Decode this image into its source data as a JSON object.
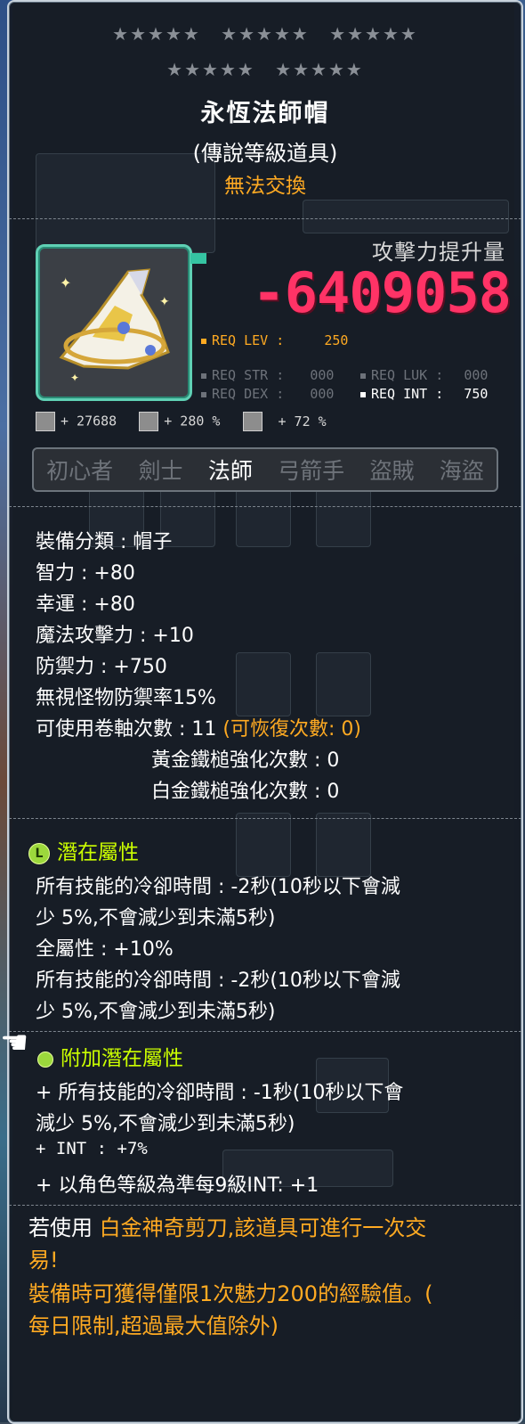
{
  "stars": {
    "row1_groups": 3,
    "row2_groups": 2,
    "per_group": 5,
    "glyph": "★"
  },
  "item": {
    "name": "永恆法師帽",
    "grade": "(傳說等級道具)",
    "trade": "無法交換"
  },
  "attack": {
    "label": "攻擊力提升量",
    "value": "-6409058"
  },
  "req": {
    "lev_label": "REQ LEV :",
    "lev_value": "250",
    "str_label": "REQ STR :",
    "str_value": "000",
    "luk_label": "REQ LUK :",
    "luk_value": "000",
    "dex_label": "REQ DEX :",
    "dex_value": "000",
    "int_label": "REQ INT :",
    "int_value": "750"
  },
  "quick_stats": {
    "a": "+ 27688",
    "b": "+ 280 %",
    "c": "+ 72 %"
  },
  "jobs": [
    "初心者",
    "劍士",
    "法師",
    "弓箭手",
    "盜賊",
    "海盜"
  ],
  "stats": {
    "category": "裝備分類 : 帽子",
    "int": "智力 : +80",
    "luk": "幸運 : +80",
    "matk": "魔法攻擊力 : +10",
    "def": "防禦力 : +750",
    "ignore_def": "無視怪物防禦率15%",
    "scroll_slots": "可使用卷軸次數 : 11",
    "scroll_restore": "(可恢復次數: 0)",
    "gold_hammer": "黃金鐵槌強化次數 : 0",
    "platinum_hammer": "白金鐵槌強化次數 : 0"
  },
  "potential": {
    "header": "潛在屬性",
    "badge": "L",
    "lines": [
      "所有技能的冷卻時間 : -2秒(10秒以下會減",
      "少 5%,不會減少到未滿5秒)",
      "全屬性 : +10%",
      "所有技能的冷卻時間 : -2秒(10秒以下會減",
      "少 5%,不會減少到未滿5秒)"
    ]
  },
  "bonus_potential": {
    "header": "附加潛在屬性",
    "lines": [
      "+ 所有技能的冷卻時間 : -1秒(10秒以下會",
      "減少 5%,不會減少到未滿5秒)",
      "+ INT : +7%",
      "+ 以角色等級為準每9級INT: +1"
    ]
  },
  "notes": {
    "prefix": "若使用",
    "scissors": "白金神奇剪刀,該道具可進行一次交",
    "scissors2": "易!",
    "charm": " 裝備時可獲得僅限1次魅力200的經驗值。(",
    "charm2": "每日限制,超過最大值除外)"
  }
}
